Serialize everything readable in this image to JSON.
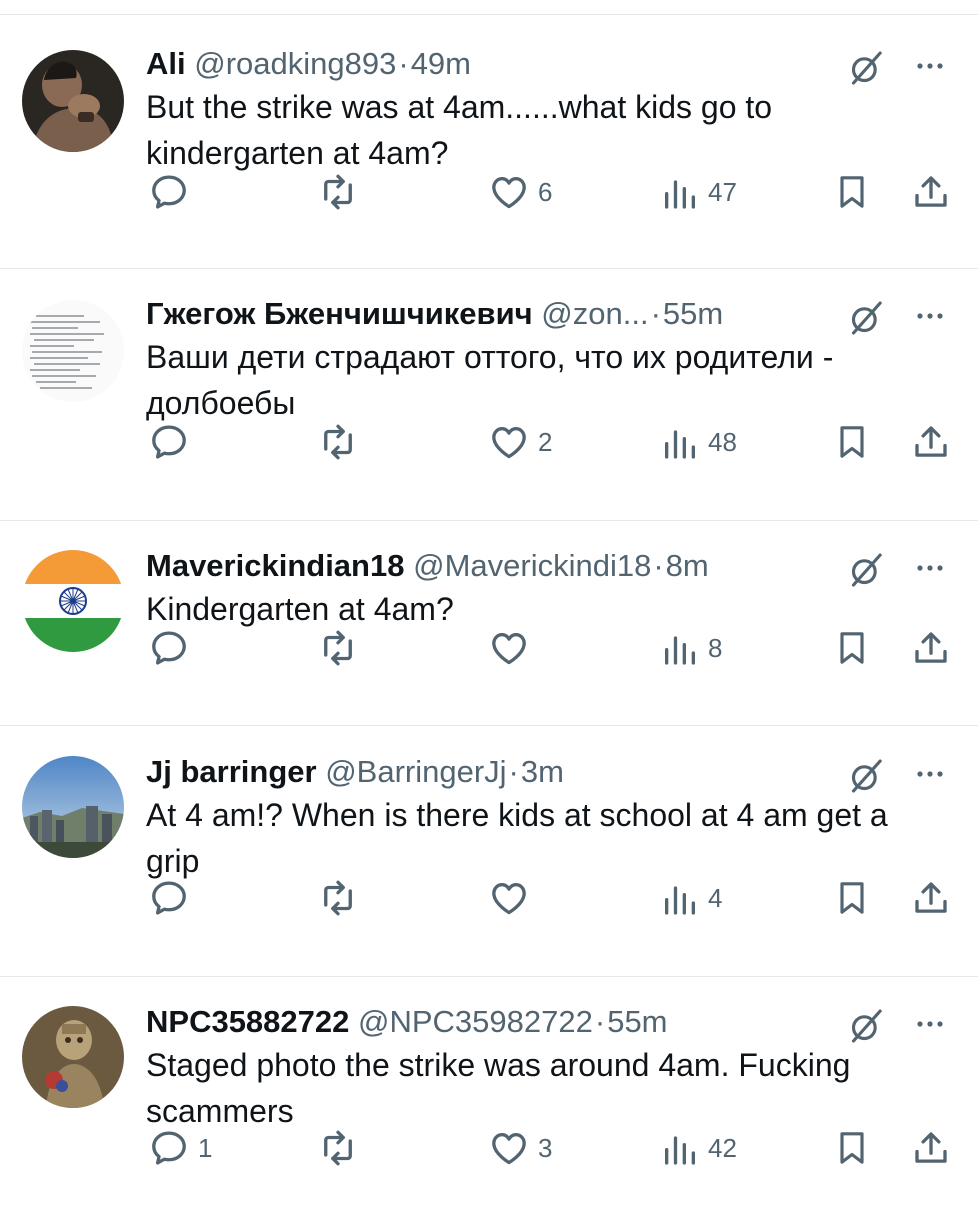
{
  "tweets": [
    {
      "name": "Ali",
      "handle": "@roadking893",
      "time": "49m",
      "text": "But the strike was at 4am......what kids go to kindergarten at 4am?",
      "replies": "",
      "retweets": "",
      "likes": "6",
      "views": "47",
      "avatar": "person-photo"
    },
    {
      "name": "Гжегож Бженчишчикевич",
      "handle": "@zon...",
      "time": "55m",
      "text": "Ваши дети страдают оттого, что их родители - долбоебы",
      "replies": "",
      "retweets": "",
      "likes": "2",
      "views": "48",
      "avatar": "text-document-image"
    },
    {
      "name": "Maverickindian18",
      "handle": "@Maverickindi18",
      "time": "8m",
      "text": "Kindergarten at 4am?",
      "replies": "",
      "retweets": "",
      "likes": "",
      "views": "8",
      "avatar": "india-flag"
    },
    {
      "name": "Jj barringer",
      "handle": "@BarringerJj",
      "time": "3m",
      "text": "At 4 am!? When is there kids at school at 4 am get a grip",
      "replies": "",
      "retweets": "",
      "likes": "",
      "views": "4",
      "avatar": "city-skyline-photo"
    },
    {
      "name": "NPC35882722",
      "handle": "@NPC35982722",
      "time": "55m",
      "text": "Staged photo the strike was around 4am. Fucking scammers",
      "replies": "1",
      "retweets": "",
      "likes": "3",
      "views": "42",
      "avatar": "figurine-photo"
    }
  ],
  "separator": "·",
  "colors": {
    "text": "#0f1419",
    "secondary": "#536471",
    "divider": "#e6e9ec"
  }
}
